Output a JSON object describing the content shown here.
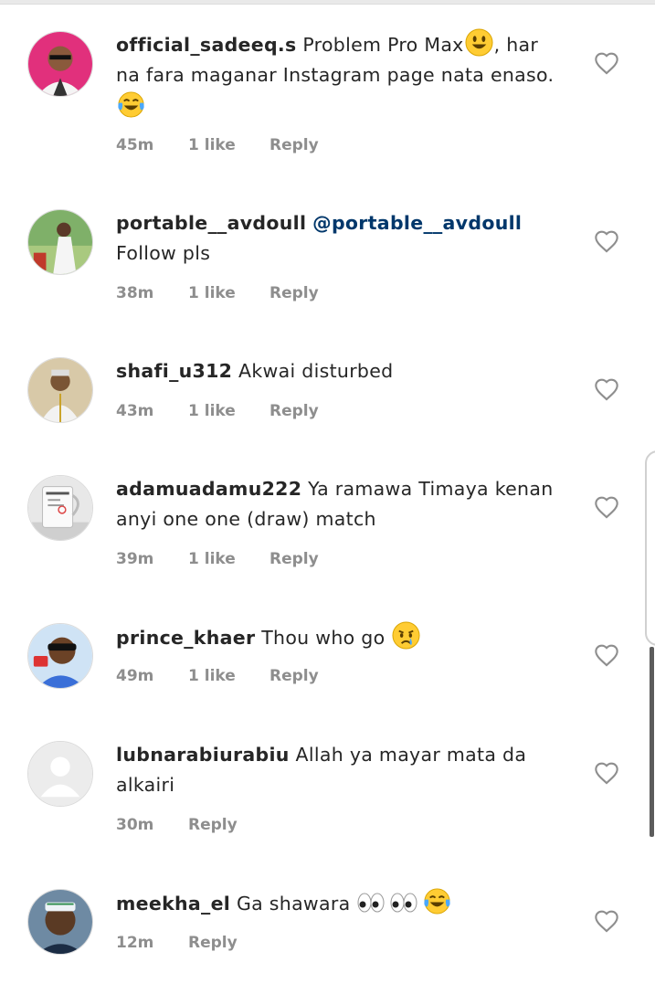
{
  "comments": [
    {
      "username": "official_sadeeq.s",
      "segments": [
        {
          "t": "Problem Pro Max"
        },
        {
          "e": "smile"
        },
        {
          "t": ", har na fara maganar Instagram page nata enaso."
        },
        {
          "e": "joy"
        }
      ],
      "time": "45m",
      "likes": "1 like",
      "reply": "Reply",
      "avatar": "pink"
    },
    {
      "username": "portable__avdoull",
      "mention": "@portable__avdoull",
      "segments": [
        {
          "t": "Follow pls"
        }
      ],
      "time": "38m",
      "likes": "1 like",
      "reply": "Reply",
      "avatar": "green"
    },
    {
      "username": "shafi_u312",
      "segments": [
        {
          "t": "Akwai disturbed"
        }
      ],
      "time": "43m",
      "likes": "1 like",
      "reply": "Reply",
      "avatar": "tan"
    },
    {
      "username": "adamuadamu222",
      "segments": [
        {
          "t": "Ya ramawa Timaya kenan anyi one one (draw) match"
        }
      ],
      "time": "39m",
      "likes": "1 like",
      "reply": "Reply",
      "avatar": "mug"
    },
    {
      "username": "prince_khaer",
      "segments": [
        {
          "t": "Thou who go "
        },
        {
          "e": "cry"
        }
      ],
      "time": "49m",
      "likes": "1 like",
      "reply": "Reply",
      "avatar": "blue"
    },
    {
      "username": "lubnarabiurabiu",
      "segments": [
        {
          "t": "Allah ya mayar mata da alkairi"
        }
      ],
      "time": "30m",
      "likes": "",
      "reply": "Reply",
      "avatar": "default"
    },
    {
      "username": "meekha_el",
      "segments": [
        {
          "t": "Ga shawara "
        },
        {
          "e": "eyes"
        },
        {
          "e": "eyes"
        },
        {
          "e": "joy"
        }
      ],
      "time": "12m",
      "likes": "",
      "reply": "Reply",
      "avatar": "dark"
    }
  ],
  "colors": {
    "text": "#262626",
    "meta": "#8e8e8e",
    "mention": "#00376b",
    "background": "#ffffff"
  },
  "icons": {
    "like": "heart-outline-icon",
    "smile": "smiling-face-emoji",
    "joy": "tears-of-joy-emoji",
    "cry": "crying-face-emoji",
    "eyes": "eyes-emoji"
  }
}
